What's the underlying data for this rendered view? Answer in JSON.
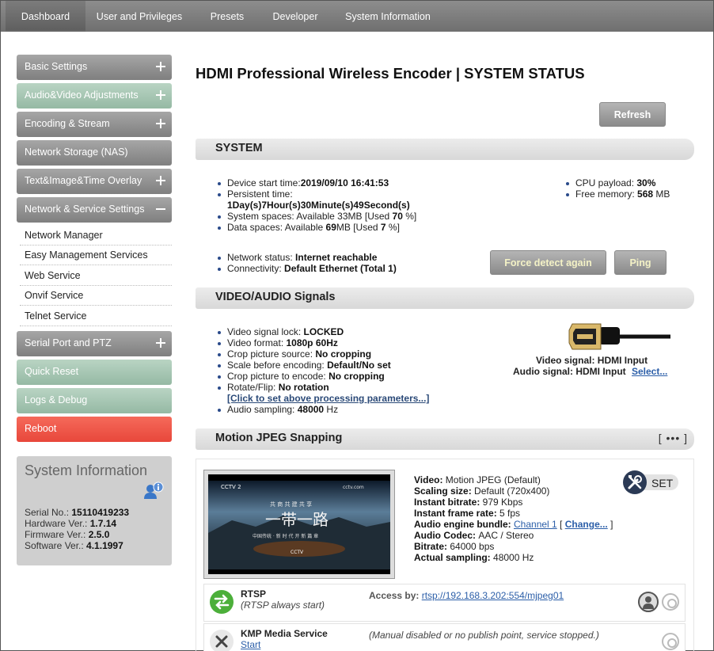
{
  "nav": {
    "tabs": [
      {
        "label": "Dashboard"
      },
      {
        "label": "User and Privileges"
      },
      {
        "label": "Presets"
      },
      {
        "label": "Developer"
      },
      {
        "label": "System Information"
      }
    ]
  },
  "sidebar": {
    "items": [
      {
        "label": "Basic Settings"
      },
      {
        "label": "Audio&Video Adjustments"
      },
      {
        "label": "Encoding & Stream"
      },
      {
        "label": "Network Storage (NAS)"
      },
      {
        "label": "Text&Image&Time Overlay"
      },
      {
        "label": "Network & Service Settings"
      },
      {
        "label": "Serial Port and PTZ"
      },
      {
        "label": "Quick Reset"
      },
      {
        "label": "Logs & Debug"
      },
      {
        "label": "Reboot"
      }
    ],
    "subitems": [
      {
        "label": "Network Manager"
      },
      {
        "label": "Easy Management Services"
      },
      {
        "label": "Web Service"
      },
      {
        "label": "Onvif Service"
      },
      {
        "label": "Telnet Service"
      }
    ]
  },
  "sysinfo": {
    "title": "System Information",
    "serial_label": "Serial No.: ",
    "serial": "15110419233",
    "hw_label": "Hardware Ver.: ",
    "hw": "1.7.14",
    "fw_label": "Firmware Ver.: ",
    "fw": "2.5.0",
    "sw_label": "Software Ver.: ",
    "sw": "4.1.1997"
  },
  "main": {
    "title": "HDMI Professional Wireless Encoder | SYSTEM STATUS",
    "refresh": "Refresh",
    "system": {
      "title": "SYSTEM",
      "start_label": "Device start time:",
      "start": "2019/09/10 16:41:53",
      "persistent_label": "Persistent time:",
      "persistent": "1Day(s)7Hour(s)30Minute(s)49Second(s)",
      "sysspace_pre": "System spaces: Available 33MB [Used ",
      "sysspace_used": "70",
      "sysspace_post": " %]",
      "dataspace_pre": "Data spaces: Available ",
      "dataspace_avail": "69",
      "dataspace_mid": "MB [Used ",
      "dataspace_used": "7",
      "dataspace_post": " %]",
      "cpu_label": "CPU payload: ",
      "cpu": "30%",
      "mem_label": "Free memory: ",
      "mem": "568",
      "mem_unit": " MB",
      "net_label": "Network status: ",
      "net": "Internet reachable",
      "conn_label": "Connectivity: ",
      "conn": "Default Ethernet (Total 1)",
      "force_btn": "Force detect again",
      "ping_btn": "Ping"
    },
    "video": {
      "title": "VIDEO/AUDIO Signals",
      "lock_label": "Video signal lock: ",
      "lock": "LOCKED",
      "format_label": "Video format: ",
      "format": "1080p 60Hz",
      "crop_src_label": "Crop picture source: ",
      "crop_src": "No cropping",
      "scale_label": "Scale before encoding: ",
      "scale": "Default/No set",
      "crop_enc_label": "Crop picture to encode: ",
      "crop_enc": "No cropping",
      "rotate_label": "Rotate/Flip: ",
      "rotate": "No rotation",
      "set_params": "[Click to set above processing parameters...]",
      "sampling_label": "Audio sampling: ",
      "sampling": "48000",
      "sampling_unit": " Hz",
      "video_signal": "Video signal: HDMI Input",
      "audio_signal": "Audio signal: HDMI Input",
      "select": "Select..."
    },
    "mjpeg": {
      "title": "Motion JPEG Snapping",
      "more": "[ ••• ]",
      "set": "SET",
      "thumb_logo": "CCTV 2",
      "thumb_site": "cctv.com",
      "thumb_text1": "共 商  共 建  共 享",
      "thumb_text2": "一带一路",
      "thumb_text3": "中国传统 · 新 时 代 开 新 篇 章",
      "thumb_logo2": "CCTV",
      "video_label": "Video: ",
      "video": "Motion JPEG (Default)",
      "scaling_label": "Scaling size: ",
      "scaling": "Default (720x400)",
      "bitrate_label": "Instant bitrate: ",
      "bitrate": "979 Kbps",
      "fps_label": "Instant frame rate: ",
      "fps": "5 fps",
      "bundle_label": "Audio engine bundle: ",
      "bundle": "Channel 1",
      "change": "Change...",
      "codec_label": "Audio Codec: ",
      "codec": "AAC / Stereo",
      "abitrate_label": "Bitrate: ",
      "abitrate": "64000 bps",
      "asampling_label": "Actual sampling: ",
      "asampling": "48000 Hz"
    },
    "services": [
      {
        "name": "RTSP",
        "sub": "(RTSP always start)",
        "access_label": "Access by: ",
        "access": "rtsp://192.168.3.202:554/mjpeg01"
      },
      {
        "name": "KMP Media Service",
        "action": "Start",
        "note": "(Manual disabled or no publish point, service stopped.)"
      }
    ]
  }
}
